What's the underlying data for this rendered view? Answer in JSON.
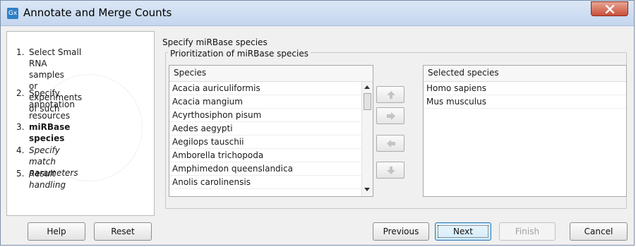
{
  "window": {
    "title": "Annotate and Merge Counts",
    "app_icon": "Gx"
  },
  "steps": [
    {
      "num": "1.",
      "line1": "Select Small RNA samples",
      "line2": "or experiments of such"
    },
    {
      "num": "2.",
      "line1": "Specify annotation",
      "line2": "resources"
    },
    {
      "num": "3.",
      "line1": "miRBase species"
    },
    {
      "num": "4.",
      "line1": "Specify match parameters"
    },
    {
      "num": "5.",
      "line1": "Result handling"
    }
  ],
  "panel": {
    "section_title": "Specify miRBase species",
    "group_title": "Prioritization of miRBase species"
  },
  "species_list": {
    "header": "Species",
    "items": [
      "Acacia auriculiformis",
      "Acacia mangium",
      "Acyrthosiphon pisum",
      "Aedes aegypti",
      "Aegilops tauschii",
      "Amborella trichopoda",
      "Amphimedon queenslandica",
      "Anolis carolinensis"
    ]
  },
  "selected_list": {
    "header": "Selected species",
    "items": [
      "Homo sapiens",
      "Mus musculus"
    ]
  },
  "buttons": {
    "help": "Help",
    "reset": "Reset",
    "previous": "Previous",
    "next": "Next",
    "finish": "Finish",
    "cancel": "Cancel"
  },
  "icons": {
    "close": "close-icon",
    "move_up": "arrow-up-icon",
    "move_right": "arrow-right-icon",
    "move_left": "arrow-left-icon",
    "move_down": "arrow-down-icon"
  }
}
